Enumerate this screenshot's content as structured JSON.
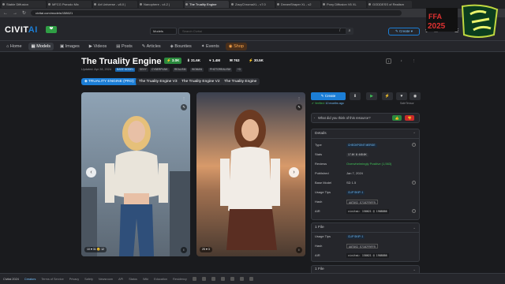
{
  "browser": {
    "tabs": [
      "Stable Diffusion",
      "MFCG Pseudo Mix",
      "Art Universe - v8.0 |",
      "Nanophere - v4.2 |",
      "The Truality Engine",
      "ZavyChromaXL - v7.0",
      "DreamShaper XL - v2",
      "Pony Diffusion V6 XL",
      "GODDESS of Realism"
    ],
    "active_tab": 4,
    "url": "civitai.com/models/158621"
  },
  "header": {
    "logo_left": "CIVIT",
    "logo_right": "AI",
    "logo_badge": "❤",
    "models_select": "Models",
    "search_placeholder": "Search Civitai",
    "search_shortcut": "/",
    "create_label": "Create"
  },
  "nav": {
    "items": [
      "Home",
      "Models",
      "Images",
      "Videos",
      "Posts",
      "Articles",
      "Bounties",
      "Events",
      "Shop"
    ],
    "active": "Models"
  },
  "model": {
    "title": "The Truality Engine",
    "stats": {
      "buzz": "3.0K",
      "downloads": "31.6K",
      "likes": "1.4M",
      "comments": "763",
      "tips": "30.5K"
    },
    "updated": "Updated: Apr 28, 2024",
    "tags": [
      "BASE MODEL",
      "SEXY",
      "CYBERPUNK",
      "REALISM",
      "WOMAN",
      "PHOTOREALISM",
      "+3"
    ],
    "versions": [
      "TRUALITY ENGINE (PRO)",
      "The Truality Engine V3",
      "The Truality Engine V2",
      "The Truality Engine"
    ],
    "active_version": 0
  },
  "gallery": {
    "photo1_reactions": "10 ♥ 31 😊 12",
    "photo2_reactions": "25 ♥ 3"
  },
  "actions": {
    "create": "Create",
    "verified": "Verified:",
    "verified_when": "10 months ago",
    "safetensor": "SafeTensor",
    "prompt_question": "What did you think of this resource?"
  },
  "details": {
    "header": "Details",
    "rows": [
      {
        "label": "Type",
        "value": "CHECKPOINT MERGE"
      },
      {
        "label": "Stats",
        "value": "17.4K  ⬇  448.6K"
      },
      {
        "label": "Reviews",
        "value": "Overwhelmingly Positive (1,563)"
      },
      {
        "label": "Published",
        "value": "Jan 7, 2024"
      },
      {
        "label": "Base Model",
        "value": "SD 1.5"
      },
      {
        "label": "Usage Tips",
        "value": "CLIP SKIP: 1"
      },
      {
        "label": "Hash",
        "value": "AUTOV2   E7187F9FF9"
      },
      {
        "label": "AIR",
        "value": "civitai: 158621 @ 1988886"
      }
    ]
  },
  "files": {
    "header": "1 File",
    "rows": [
      {
        "label": "Usage Tips",
        "value": "CLIP SKIP: 1"
      },
      {
        "label": "Hash",
        "value": "AUTOV2   E7187F9FF9"
      },
      {
        "label": "AIR",
        "value": "civitai: 158621 @ 1988886"
      }
    ],
    "header2": "1 File"
  },
  "footer": {
    "brand": "Civitai 2024",
    "links": [
      "Creators",
      "Terms of Service",
      "Privacy",
      "Safety",
      "Newsroom",
      "API",
      "Status",
      "Wiki",
      "Education",
      "Residency"
    ]
  },
  "colors": {
    "accent": "#1c7ed6",
    "green": "#40c057",
    "background": "#1a1b1e"
  }
}
